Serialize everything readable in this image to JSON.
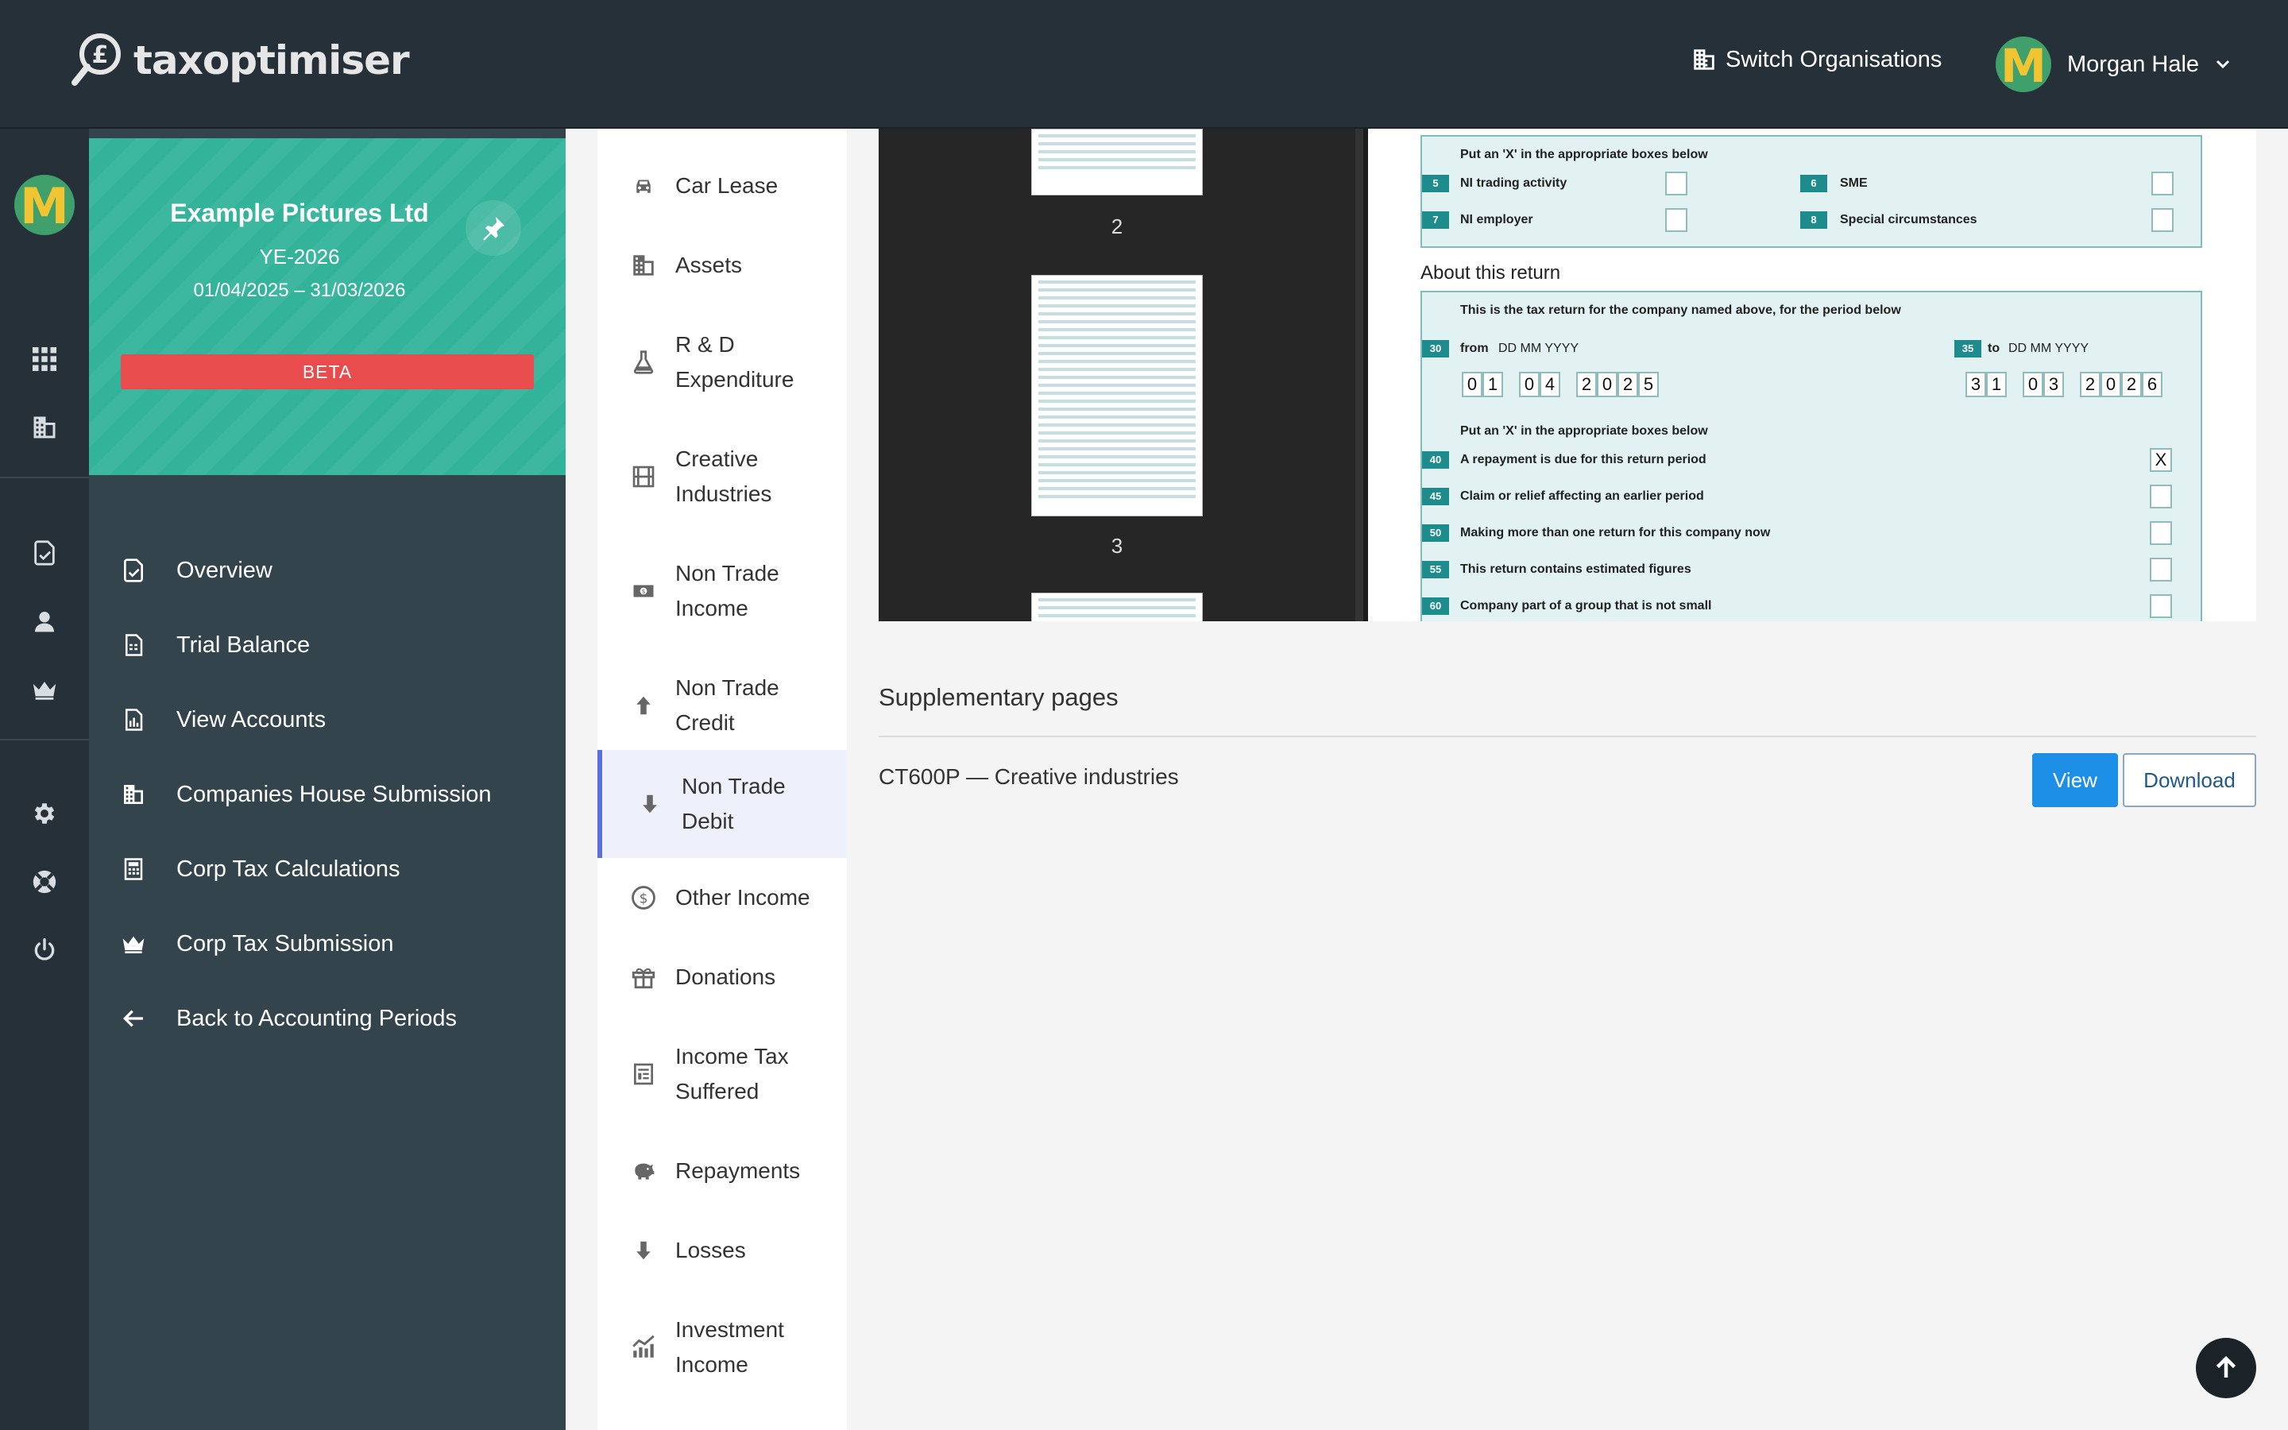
{
  "header": {
    "logo_text": "taxoptimiser",
    "switch_org_label": "Switch Organisations",
    "user_name": "Morgan Hale",
    "avatar_letter": "M"
  },
  "sidebar": {
    "company_name": "Example Pictures Ltd",
    "year_end": "YE-2026",
    "period": "01/04/2025 – 31/03/2026",
    "beta_label": "BETA",
    "items": [
      {
        "label": "Overview",
        "icon": "document-check-icon"
      },
      {
        "label": "Trial Balance",
        "icon": "spreadsheet-icon"
      },
      {
        "label": "View Accounts",
        "icon": "report-chart-icon"
      },
      {
        "label": "Companies House Submission",
        "icon": "building-icon"
      },
      {
        "label": "Corp Tax Calculations",
        "icon": "calculator-icon"
      },
      {
        "label": "Corp Tax Submission",
        "icon": "crown-icon"
      },
      {
        "label": "Back to Accounting Periods",
        "icon": "arrow-left-icon"
      }
    ]
  },
  "submenu": {
    "items": [
      {
        "label": "Car Lease",
        "icon": "car-icon"
      },
      {
        "label": "Assets",
        "icon": "building-icon"
      },
      {
        "label": "R & D Expenditure",
        "icon": "flask-icon"
      },
      {
        "label": "Creative Industries",
        "icon": "film-icon"
      },
      {
        "label": "Non Trade Income",
        "icon": "cash-icon"
      },
      {
        "label": "Non Trade Credit",
        "icon": "arrow-up-icon"
      },
      {
        "label": "Non Trade Debit",
        "icon": "arrow-down-icon"
      },
      {
        "label": "Other Income",
        "icon": "dollar-circle-icon"
      },
      {
        "label": "Donations",
        "icon": "gift-icon"
      },
      {
        "label": "Income Tax Suffered",
        "icon": "receipt-icon"
      },
      {
        "label": "Repayments",
        "icon": "piggy-bank-icon"
      },
      {
        "label": "Losses",
        "icon": "arrow-down-icon"
      },
      {
        "label": "Investment Income",
        "icon": "chart-up-icon"
      }
    ],
    "active": "Non Trade Debit"
  },
  "viewer": {
    "thumb_labels": [
      "2",
      "3"
    ],
    "form": {
      "put_x_top": "Put an 'X' in the appropriate boxes below",
      "box5": "5",
      "box5_label": "NI trading activity",
      "box6": "6",
      "box6_label": "SME",
      "box7": "7",
      "box7_label": "NI employer",
      "box8": "8",
      "box8_label": "Special circumstances",
      "about_title": "About this return",
      "about_intro": "This is the tax return for the company named above, for the period below",
      "box30": "30",
      "from_label": "from",
      "from_fmt": "DD MM YYYY",
      "box35": "35",
      "to_label": "to",
      "to_fmt": "DD MM YYYY",
      "from_digits": [
        "0",
        "1",
        "0",
        "4",
        "2",
        "0",
        "2",
        "5"
      ],
      "to_digits": [
        "3",
        "1",
        "0",
        "3",
        "2",
        "0",
        "2",
        "6"
      ],
      "put_x_mid": "Put an 'X' in the appropriate boxes below",
      "box40": "40",
      "box40_label": "A repayment is due for this return period",
      "box40_value": "X",
      "box45": "45",
      "box45_label": "Claim or relief affecting an earlier period",
      "box50": "50",
      "box50_label": "Making more than one return for this company now",
      "box55": "55",
      "box55_label": "This return contains estimated figures",
      "box60": "60",
      "box60_label": "Company part of a group that is not small"
    }
  },
  "supplementary": {
    "title": "Supplementary pages",
    "row_label": "CT600P — Creative industries",
    "view_label": "View",
    "download_label": "Download"
  },
  "colors": {
    "topbar": "#253038",
    "sidebar": "#34444d",
    "company_card": "#34b39b",
    "beta": "#e84c4c",
    "primary": "#1e8fe6",
    "active_border": "#5d6fd8"
  }
}
